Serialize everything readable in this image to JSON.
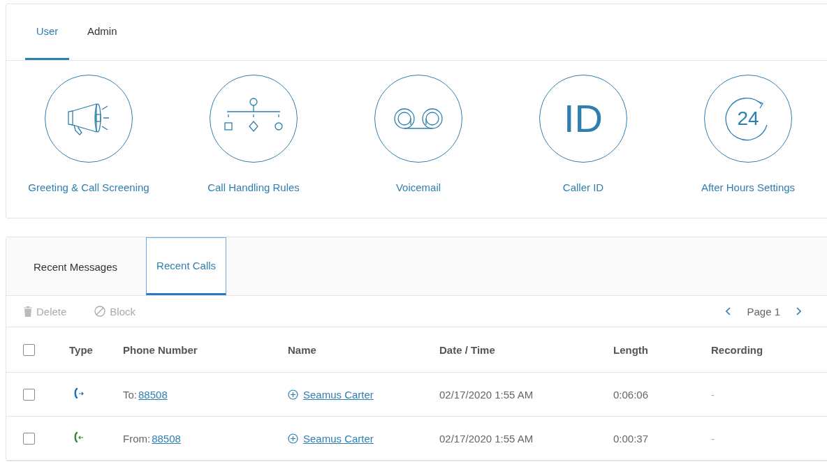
{
  "user_tabs": [
    {
      "label": "User",
      "selected": true
    },
    {
      "label": "Admin",
      "selected": false
    }
  ],
  "features": [
    {
      "label": "Greeting & Call Screening",
      "kind": "megaphone"
    },
    {
      "label": "Call Handling Rules",
      "kind": "rules"
    },
    {
      "label": "Voicemail",
      "kind": "voicemail"
    },
    {
      "label": "Caller ID",
      "kind": "callerid",
      "glyph": "ID"
    },
    {
      "label": "After Hours Settings",
      "kind": "afterhours",
      "glyph": "24"
    }
  ],
  "list_tabs": [
    {
      "label": "Recent Messages",
      "selected": false
    },
    {
      "label": "Recent Calls",
      "selected": true
    }
  ],
  "toolbar": {
    "actions": [
      {
        "label": "Delete",
        "kind": "delete",
        "disabled": true
      },
      {
        "label": "Block",
        "kind": "block",
        "disabled": true
      }
    ],
    "page": "Page 1"
  },
  "table": {
    "select_all_checked": false,
    "columns": [
      "Type",
      "Phone Number",
      "Name",
      "Date / Time",
      "Length",
      "Recording"
    ],
    "rows": [
      {
        "checked": false,
        "kind": "outgoing",
        "phone_prefix": "To:",
        "phone": "88508",
        "name": "Seamus Carter",
        "datetime": "02/17/2020 1:55 AM",
        "length": "0:06:06",
        "recording": "-"
      },
      {
        "checked": false,
        "kind": "incoming",
        "phone_prefix": "From:",
        "phone": "88508",
        "name": "Seamus Carter",
        "datetime": "02/17/2020 1:55 AM",
        "length": "0:00:37",
        "recording": "-"
      }
    ]
  }
}
